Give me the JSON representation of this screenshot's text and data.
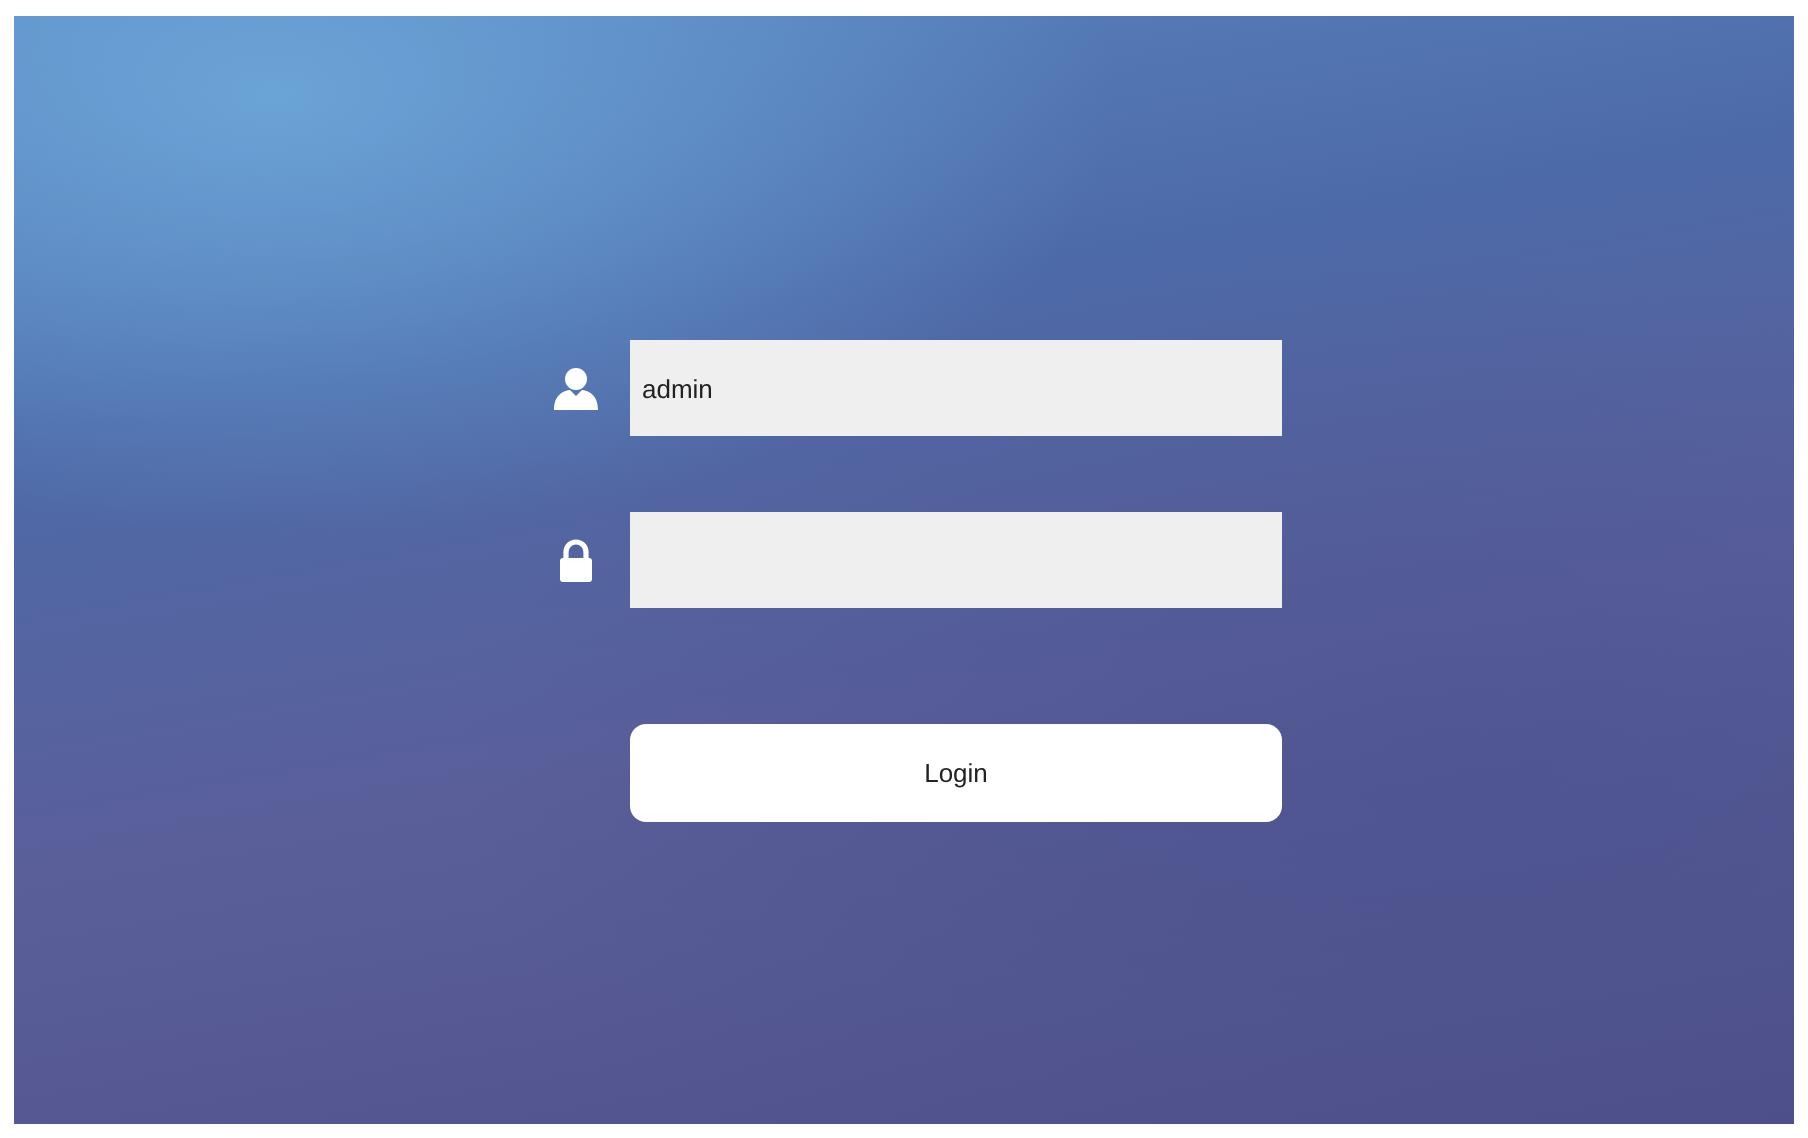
{
  "fields": [
    {
      "kind": "user",
      "value": "admin"
    },
    {
      "kind": "password"
    }
  ],
  "login_button": {
    "label": "Login"
  }
}
